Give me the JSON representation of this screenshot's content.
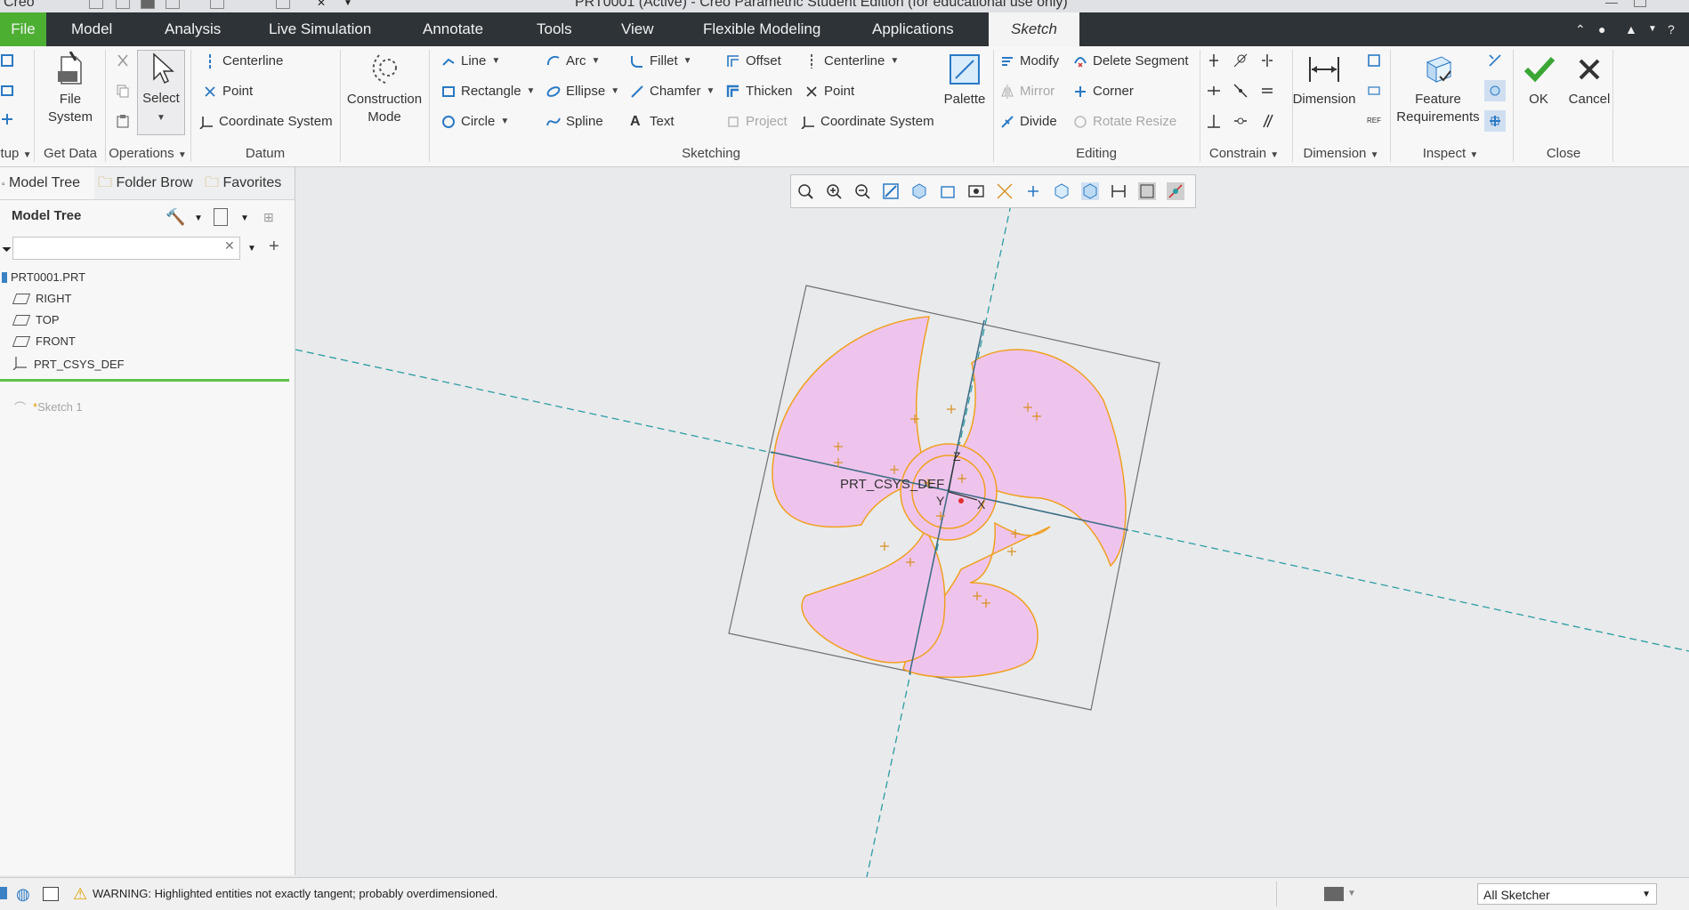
{
  "window": {
    "title": "PRT0001 (Active) - Creo Parametric Student Edition (for educational use only)",
    "app_name": "Creo"
  },
  "menu": {
    "items": [
      "File",
      "Model",
      "Analysis",
      "Live Simulation",
      "Annotate",
      "Tools",
      "View",
      "Flexible Modeling",
      "Applications",
      "Sketch"
    ],
    "active": "Sketch",
    "file_color": "#4caf32"
  },
  "ribbon": {
    "getdata": {
      "file_system": "File System",
      "group": "Get Data",
      "setup_group": "tup"
    },
    "operations": {
      "select": "Select",
      "group": "Operations"
    },
    "datum": {
      "centerline": "Centerline",
      "point": "Point",
      "coordinate_system": "Coordinate System",
      "group": "Datum"
    },
    "construction": {
      "label": "Construction Mode"
    },
    "sketching": {
      "line": "Line",
      "rectangle": "Rectangle",
      "circle": "Circle",
      "arc": "Arc",
      "ellipse": "Ellipse",
      "spline": "Spline",
      "fillet": "Fillet",
      "chamfer": "Chamfer",
      "text": "Text",
      "offset": "Offset",
      "thicken": "Thicken",
      "project": "Project",
      "centerline": "Centerline",
      "point": "Point",
      "coordinate_system": "Coordinate System",
      "palette": "Palette",
      "group": "Sketching"
    },
    "editing": {
      "modify": "Modify",
      "mirror": "Mirror",
      "divide": "Divide",
      "delete_segment": "Delete Segment",
      "corner": "Corner",
      "rotate_resize": "Rotate Resize",
      "group": "Editing"
    },
    "constrain": {
      "group": "Constrain"
    },
    "dimension": {
      "label": "Dimension",
      "group": "Dimension"
    },
    "inspect": {
      "feature_requirements": "Feature Requirements",
      "group": "Inspect"
    },
    "close": {
      "ok": "OK",
      "cancel": "Cancel",
      "group": "Close"
    }
  },
  "left_panel": {
    "tabs": [
      "Model Tree",
      "Folder Brow",
      "Favorites"
    ],
    "header": "Model Tree",
    "search": {
      "value": "",
      "placeholder": ""
    },
    "items": [
      "PRT0001.PRT",
      "RIGHT",
      "TOP",
      "FRONT",
      "PRT_CSYS_DEF"
    ],
    "inserted_item": "Sketch 1"
  },
  "graphics": {
    "csys_label": "PRT_CSYS_DEF",
    "axis_z": "Z",
    "axis_y": "Y",
    "axis_x": "X",
    "fill_color": "#efc4ec",
    "outline_color": "#f0a020"
  },
  "status": {
    "message": "WARNING: Highlighted entities not exactly tangent; probably overdimensioned.",
    "filter": "All Sketcher"
  }
}
